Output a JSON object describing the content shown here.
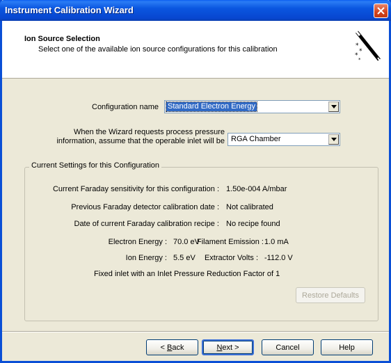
{
  "window": {
    "title": "Instrument Calibration Wizard"
  },
  "header": {
    "title": "Ion Source Selection",
    "subtitle": "Select one of the available ion source configurations for this calibration"
  },
  "form": {
    "config_label": "Configuration name",
    "config_value": "Standard Electron Energy",
    "inlet_label_line1": "When the Wizard requests process pressure",
    "inlet_label_line2": "information, assume that the operable inlet will be",
    "inlet_value": "RGA Chamber"
  },
  "settings": {
    "group_title": "Current Settings for this Configuration",
    "sensitivity_label": "Current Faraday sensitivity for this configuration :",
    "sensitivity_value": "1.50e-004 A/mbar",
    "prev_cal_label": "Previous Faraday detector calibration date :",
    "prev_cal_value": "Not calibrated",
    "recipe_label": "Date of current Faraday calibration recipe :",
    "recipe_value": "No recipe found",
    "electron_energy_label": "Electron Energy :",
    "electron_energy_value": "70.0 eV",
    "filament_emission_label": "Filament Emission :",
    "filament_emission_value": "1.0 mA",
    "ion_energy_label": "Ion Energy :",
    "ion_energy_value": "5.5 eV",
    "extractor_volts_label": "Extractor Volts :",
    "extractor_volts_value": "-112.0 V",
    "inlet_note": "Fixed inlet with an Inlet Pressure Reduction Factor of  1",
    "restore_label": "Restore Defaults"
  },
  "buttons": {
    "back_accel": "B",
    "back_rest": "ack",
    "back_prefix": "< ",
    "next_accel": "N",
    "next_rest": "ext >",
    "cancel": "Cancel",
    "help": "Help"
  },
  "colors": {
    "titlebar": "#0a56e0",
    "selection": "#316ac5",
    "face": "#ece9d8"
  }
}
